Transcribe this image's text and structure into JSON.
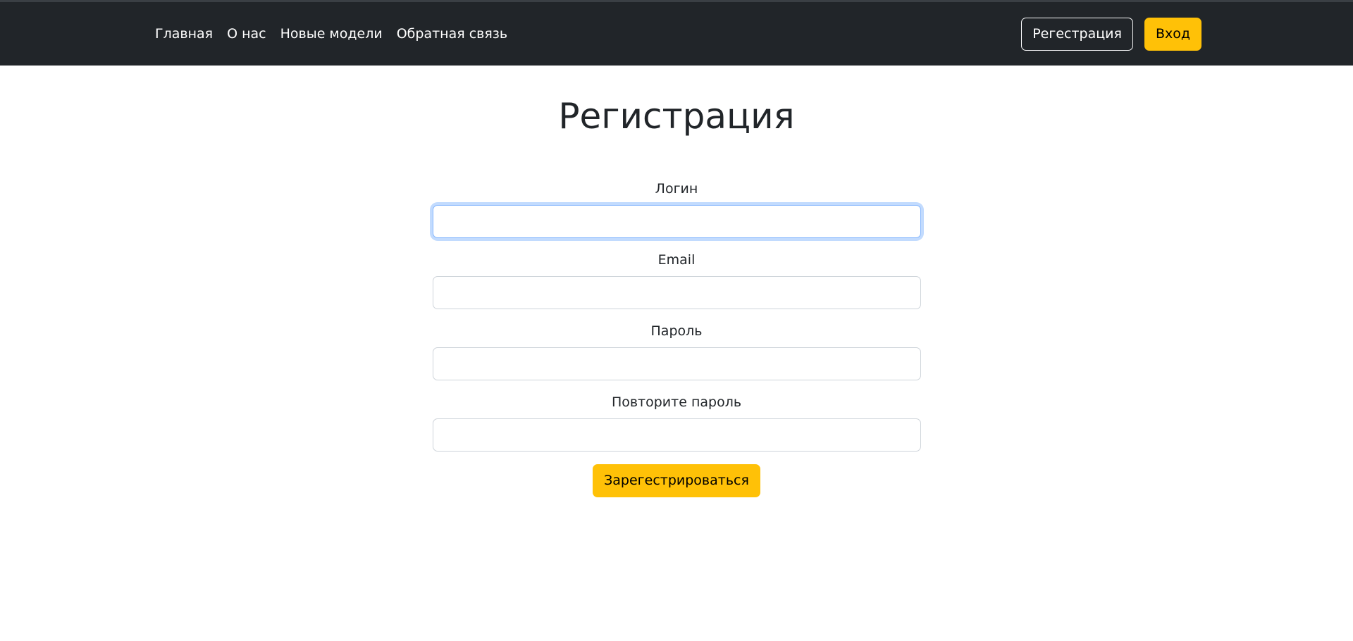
{
  "nav": {
    "links": [
      "Главная",
      "О нас",
      "Новые модели",
      "Обратная связь"
    ],
    "register_label": "Регестрация",
    "login_label": "Вход"
  },
  "page": {
    "title": "Регистрация"
  },
  "form": {
    "fields": [
      {
        "label": "Логин",
        "value": ""
      },
      {
        "label": "Email",
        "value": ""
      },
      {
        "label": "Пароль",
        "value": ""
      },
      {
        "label": "Повторите пароль",
        "value": ""
      }
    ],
    "submit_label": "Зарегестрироваться"
  },
  "colors": {
    "navbar_bg": "#212529",
    "accent": "#ffc107",
    "focus_border": "#86b7fe"
  }
}
